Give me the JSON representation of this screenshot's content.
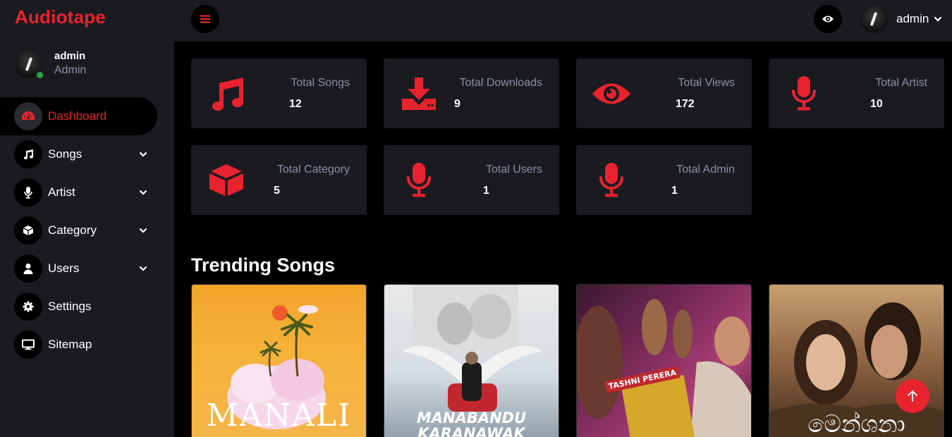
{
  "brand": "Audiotape",
  "profile": {
    "name": "admin",
    "role": "Admin"
  },
  "topbar": {
    "user_name": "admin"
  },
  "nav": [
    {
      "label": "Dashboard",
      "icon": "dashboard-icon",
      "active": true,
      "has_submenu": false
    },
    {
      "label": "Songs",
      "icon": "music-icon",
      "active": false,
      "has_submenu": true
    },
    {
      "label": "Artist",
      "icon": "microphone-icon",
      "active": false,
      "has_submenu": true
    },
    {
      "label": "Category",
      "icon": "cube-icon",
      "active": false,
      "has_submenu": true
    },
    {
      "label": "Users",
      "icon": "user-icon",
      "active": false,
      "has_submenu": true
    },
    {
      "label": "Settings",
      "icon": "gear-icon",
      "active": false,
      "has_submenu": false
    },
    {
      "label": "Sitemap",
      "icon": "desktop-icon",
      "active": false,
      "has_submenu": false
    }
  ],
  "stats": [
    {
      "label": "Total Songs",
      "value": "12",
      "icon": "music-icon"
    },
    {
      "label": "Total Downloads",
      "value": "9",
      "icon": "download-icon"
    },
    {
      "label": "Total Views",
      "value": "172",
      "icon": "eye-icon"
    },
    {
      "label": "Total Artist",
      "value": "10",
      "icon": "microphone-icon"
    },
    {
      "label": "Total Category",
      "value": "5",
      "icon": "cube-icon"
    },
    {
      "label": "Total Users",
      "value": "1",
      "icon": "microphone-icon"
    },
    {
      "label": "Total Admin",
      "value": "1",
      "icon": "microphone-icon"
    }
  ],
  "trending": {
    "title": "Trending Songs",
    "songs": [
      {
        "cover_text": "MANALI"
      },
      {
        "cover_text": "MANABANDU KARANAWAK"
      },
      {
        "cover_text": "TASHNI PERERA"
      },
      {
        "cover_text": "මෙන්ශනා"
      }
    ]
  },
  "colors": {
    "accent": "#e8232e",
    "panel": "#1a1b21",
    "background": "#000000",
    "muted_text": "#8a8fa3"
  }
}
